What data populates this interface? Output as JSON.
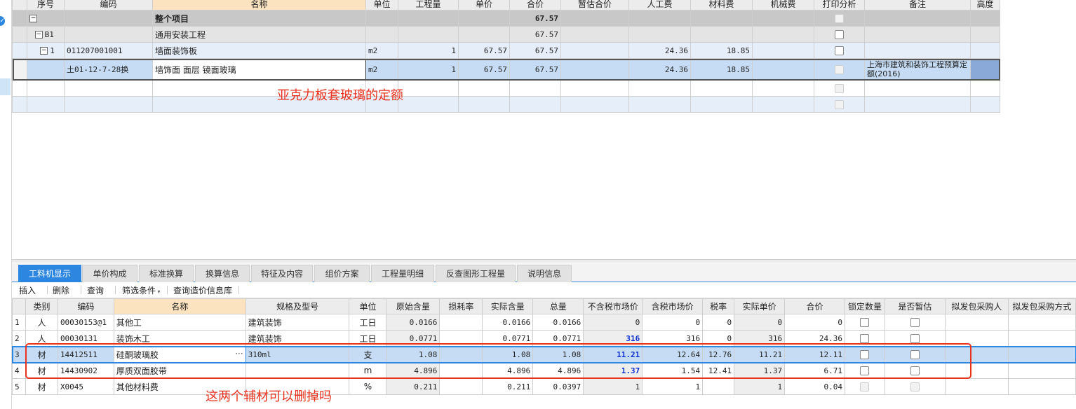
{
  "top_grid": {
    "headers": [
      "序号",
      "编码",
      "名称",
      "单位",
      "工程量",
      "单价",
      "合价",
      "暂估合价",
      "人工费",
      "材料费",
      "机械费",
      "打印分析",
      "备注",
      "高度"
    ],
    "rows": [
      {
        "seq": "",
        "code": "",
        "name": "整个项目",
        "unit": "",
        "qty": "",
        "price": "",
        "total": "67.57",
        "est": "",
        "labor": "",
        "mat": "",
        "mach": "",
        "remark": ""
      },
      {
        "seq": "B1",
        "code": "",
        "name": "通用安装工程",
        "unit": "",
        "qty": "",
        "price": "",
        "total": "67.57",
        "est": "",
        "labor": "",
        "mat": "",
        "mach": "",
        "remark": ""
      },
      {
        "seq": "1",
        "code": "011207001001",
        "name": "墙面装饰板",
        "unit": "m2",
        "qty": "1",
        "price": "67.57",
        "total": "67.57",
        "est": "",
        "labor": "24.36",
        "mat": "18.85",
        "mach": "",
        "remark": ""
      },
      {
        "seq": "",
        "code": "土01-12-7-28换",
        "name": "墙饰面 面层 镜面玻璃",
        "unit": "m2",
        "qty": "1",
        "price": "67.57",
        "total": "67.57",
        "est": "",
        "labor": "24.36",
        "mat": "18.85",
        "mach": "",
        "remark": "上海市建筑和装饰工程预算定额(2016)"
      }
    ]
  },
  "annotations": {
    "top": "亚克力板套玻璃的定额",
    "bottom": "这两个辅材可以删掉吗"
  },
  "tabs": [
    "工料机显示",
    "单价构成",
    "标准换算",
    "换算信息",
    "特征及内容",
    "组价方案",
    "工程量明细",
    "反查图形工程量",
    "说明信息"
  ],
  "toolbar": {
    "insert": "插入",
    "delete": "删除",
    "query": "查询",
    "filter": "筛选条件",
    "lookup": "查询造价信息库"
  },
  "bottom_grid": {
    "headers": [
      "",
      "类别",
      "编码",
      "名称",
      "规格及型号",
      "单位",
      "原始含量",
      "损耗率",
      "实际含量",
      "总量",
      "不含税市场价",
      "含税市场价",
      "税率",
      "实际单价",
      "合价",
      "锁定数量",
      "是否暂估",
      "拟发包采购人",
      "拟发包采购方式"
    ],
    "rows": [
      {
        "n": "1",
        "cat": "人",
        "code": "00030153@1",
        "name": "其他工",
        "spec": "建筑装饰",
        "unit": "工日",
        "orig": "0.0166",
        "loss": "",
        "actual": "0.0166",
        "total": "0.0166",
        "mkt": "0",
        "mkt_tax": "0",
        "rate": "0",
        "real": "0",
        "sum": "0"
      },
      {
        "n": "2",
        "cat": "人",
        "code": "00030131",
        "name": "装饰木工",
        "spec": "建筑装饰",
        "unit": "工日",
        "orig": "0.0771",
        "loss": "",
        "actual": "0.0771",
        "total": "0.0771",
        "mkt": "316",
        "mkt_tax": "316",
        "rate": "0",
        "real": "316",
        "sum": "24.36"
      },
      {
        "n": "3",
        "cat": "材",
        "code": "14412511",
        "name": "硅酮玻璃胶",
        "spec": "310ml",
        "unit": "支",
        "orig": "1.08",
        "loss": "",
        "actual": "1.08",
        "total": "1.08",
        "mkt": "11.21",
        "mkt_tax": "12.64",
        "rate": "12.76",
        "real": "11.21",
        "sum": "12.11"
      },
      {
        "n": "4",
        "cat": "材",
        "code": "14430902",
        "name": "厚质双面胶带",
        "spec": "",
        "unit": "m",
        "orig": "4.896",
        "loss": "",
        "actual": "4.896",
        "total": "4.896",
        "mkt": "1.37",
        "mkt_tax": "1.54",
        "rate": "12.41",
        "real": "1.37",
        "sum": "6.71"
      },
      {
        "n": "5",
        "cat": "材",
        "code": "X0045",
        "name": "其他材料费",
        "spec": "",
        "unit": "%",
        "orig": "0.211",
        "loss": "",
        "actual": "0.211",
        "total": "0.0397",
        "mkt": "1",
        "mkt_tax": "1",
        "rate": "",
        "real": "1",
        "sum": "0.04"
      }
    ]
  },
  "colors": {
    "accent": "#2d86e0",
    "annotation": "#e8321e",
    "selected_row": "#c6dcf4",
    "header_name": "#fbe3bf"
  }
}
